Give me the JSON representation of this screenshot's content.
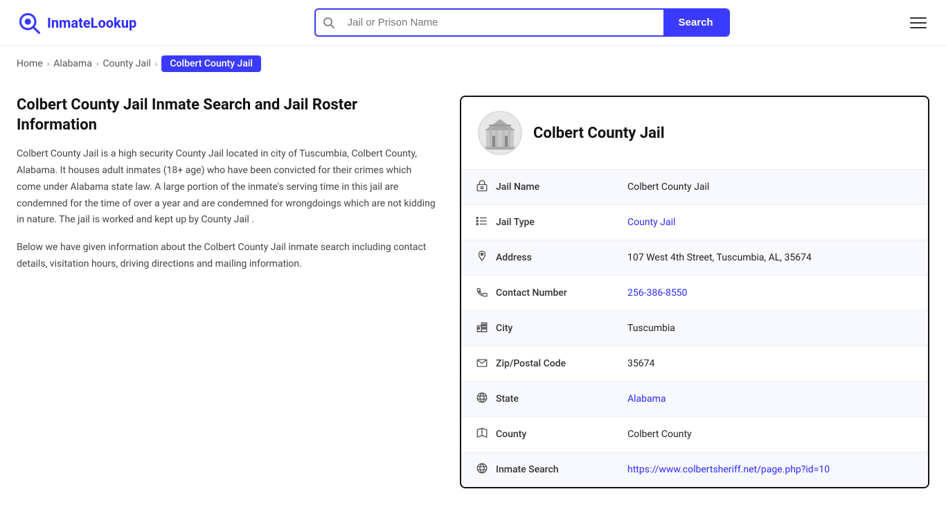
{
  "site": {
    "name": "InmateLookup",
    "logo_letter": "Q"
  },
  "header": {
    "search_placeholder": "Jail or Prison Name",
    "search_button_label": "Search",
    "hamburger_label": "Menu"
  },
  "breadcrumb": {
    "items": [
      {
        "label": "Home",
        "href": "#"
      },
      {
        "label": "Alabama",
        "href": "#"
      },
      {
        "label": "County Jail",
        "href": "#"
      },
      {
        "label": "Colbert County Jail",
        "current": true
      }
    ]
  },
  "left": {
    "title": "Colbert County Jail Inmate Search and Jail Roster Information",
    "description1": "Colbert County Jail is a high security County Jail located in city of Tuscumbia, Colbert County, Alabama. It houses adult inmates (18+ age) who have been convicted for their crimes which come under Alabama state law. A large portion of the inmate's serving time in this jail are condemned for the time of over a year and are condemned for wrongdoings which are not kidding in nature. The jail is worked and kept up by County Jail .",
    "description2": "Below we have given information about the Colbert County Jail inmate search including contact details, visitation hours, driving directions and mailing information."
  },
  "card": {
    "facility_name": "Colbert County Jail",
    "rows": [
      {
        "icon": "jail-icon",
        "label": "Jail Name",
        "value": "Colbert County Jail",
        "link": null
      },
      {
        "icon": "list-icon",
        "label": "Jail Type",
        "value": "County Jail",
        "link": "#"
      },
      {
        "icon": "pin-icon",
        "label": "Address",
        "value": "107 West 4th Street, Tuscumbia, AL, 35674",
        "link": null
      },
      {
        "icon": "phone-icon",
        "label": "Contact Number",
        "value": "256-386-8550",
        "link": "tel:256-386-8550"
      },
      {
        "icon": "city-icon",
        "label": "City",
        "value": "Tuscumbia",
        "link": null
      },
      {
        "icon": "mail-icon",
        "label": "Zip/Postal Code",
        "value": "35674",
        "link": null
      },
      {
        "icon": "globe-icon",
        "label": "State",
        "value": "Alabama",
        "link": "#"
      },
      {
        "icon": "county-icon",
        "label": "County",
        "value": "Colbert County",
        "link": null
      },
      {
        "icon": "globe2-icon",
        "label": "Inmate Search",
        "value": "https://www.colbertsheriff.net/page.php?id=10",
        "link": "https://www.colbertsheriff.net/page.php?id=10"
      }
    ]
  }
}
